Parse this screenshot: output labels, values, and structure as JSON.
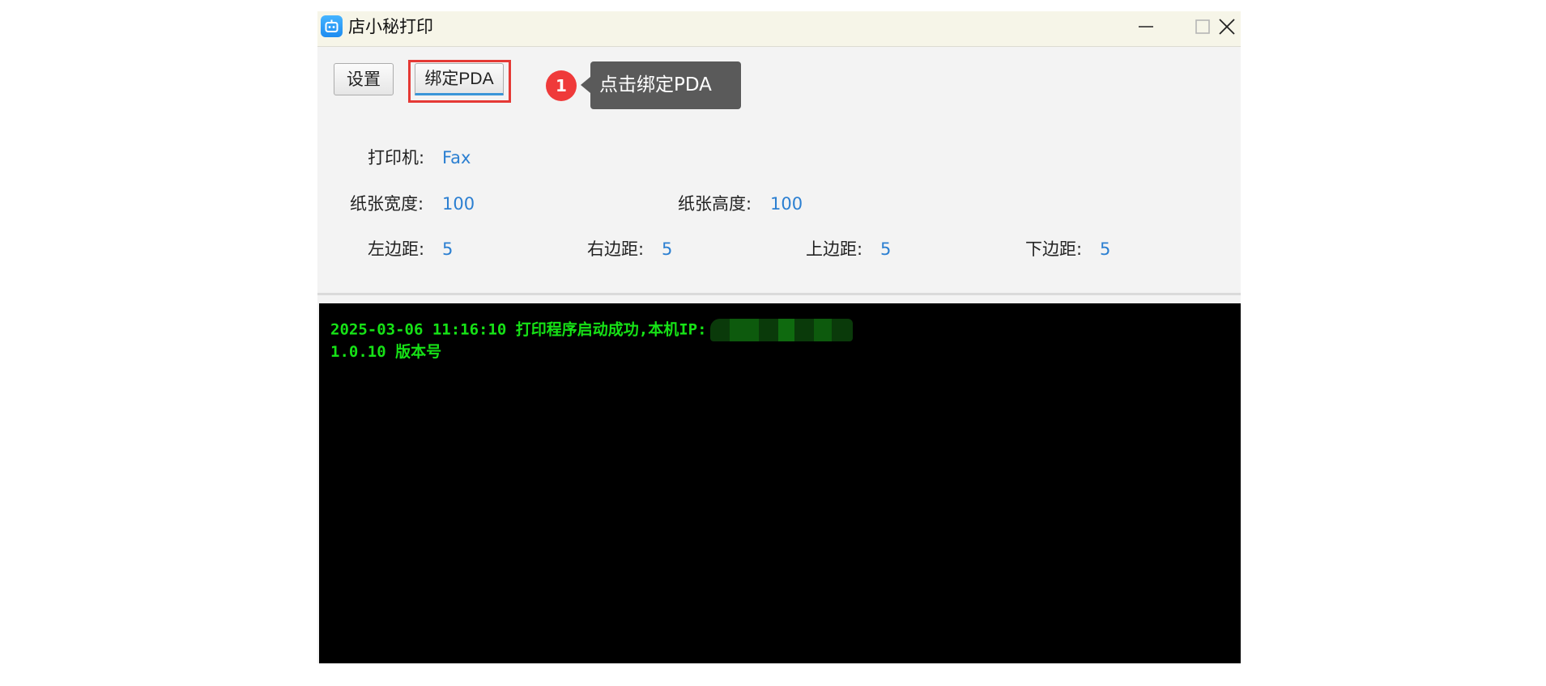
{
  "window": {
    "title": "店小秘打印",
    "icon": "robot-icon",
    "controls": [
      "minimize-icon",
      "maximize-icon",
      "close-icon"
    ]
  },
  "toolbar": {
    "settings_label": "设置",
    "bind_pda_label": "绑定PDA"
  },
  "guide": {
    "step_number": "1",
    "tooltip_text": "点击绑定PDA",
    "highlight_color": "#e53935",
    "badge_color": "#ef3a3a"
  },
  "fields": {
    "printer": {
      "label": "打印机:",
      "value": "Fax"
    },
    "paper_width": {
      "label": "纸张宽度:",
      "value": "100"
    },
    "paper_height": {
      "label": "纸张高度:",
      "value": "100"
    },
    "margin_left": {
      "label": "左边距:",
      "value": "5"
    },
    "margin_right": {
      "label": "右边距:",
      "value": "5"
    },
    "margin_top": {
      "label": "上边距:",
      "value": "5"
    },
    "margin_bottom": {
      "label": "下边距:",
      "value": "5"
    }
  },
  "console": {
    "lines": [
      "2025-03-06 11:16:10 打印程序启动成功,本机IP:",
      "1.0.10 版本号"
    ],
    "text_color": "#16e216",
    "background": "#000000"
  },
  "colors": {
    "value_blue": "#2b7fd1",
    "titlebar": "#f6f5e8"
  }
}
